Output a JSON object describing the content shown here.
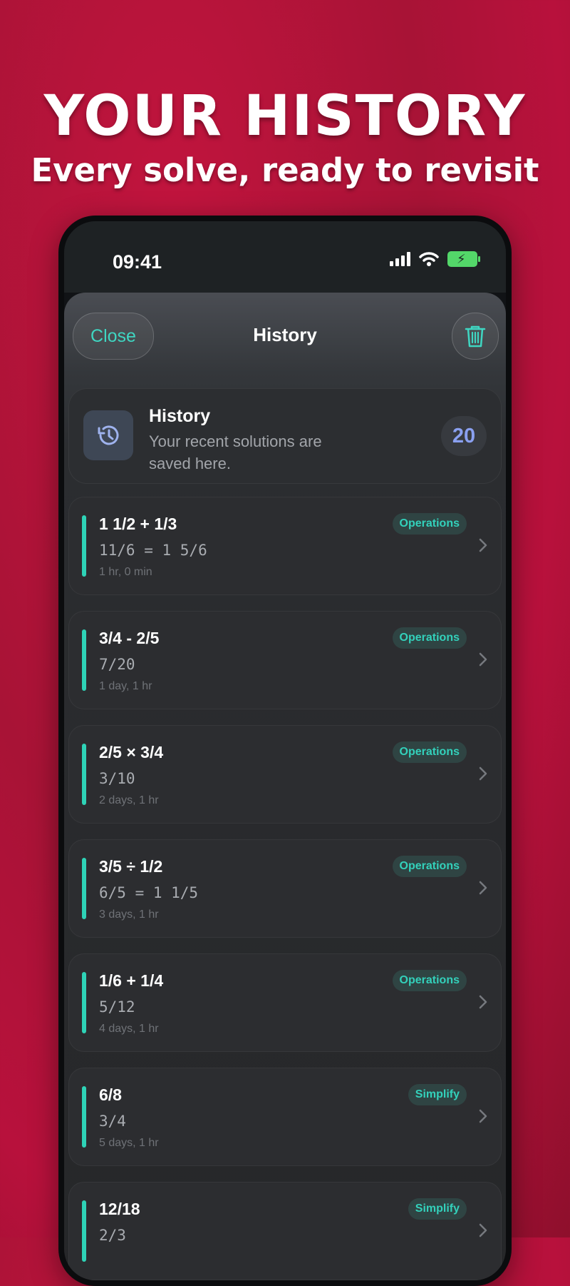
{
  "promo": {
    "title": "YOUR HISTORY",
    "subtitle": "Every solve, ready to revisit"
  },
  "status_bar": {
    "time": "09:41"
  },
  "header": {
    "close_label": "Close",
    "title": "History"
  },
  "summary": {
    "title": "History",
    "description": "Your recent solutions are saved here.",
    "count": "20"
  },
  "colors": {
    "accent": "#2ed3b7",
    "count_text": "#8aa0f0",
    "background": "#b8113c"
  },
  "items": [
    {
      "expression": "1 1/2 + 1/3",
      "result": "11/6 = 1 5/6",
      "time": "1 hr, 0 min",
      "tag": "Operations"
    },
    {
      "expression": "3/4 - 2/5",
      "result": "7/20",
      "time": "1 day, 1 hr",
      "tag": "Operations"
    },
    {
      "expression": "2/5 × 3/4",
      "result": "3/10",
      "time": "2 days, 1 hr",
      "tag": "Operations"
    },
    {
      "expression": "3/5 ÷ 1/2",
      "result": "6/5 = 1 1/5",
      "time": "3 days, 1 hr",
      "tag": "Operations"
    },
    {
      "expression": "1/6 + 1/4",
      "result": "5/12",
      "time": "4 days, 1 hr",
      "tag": "Operations"
    },
    {
      "expression": "6/8",
      "result": "3/4",
      "time": "5 days, 1 hr",
      "tag": "Simplify"
    },
    {
      "expression": "12/18",
      "result": "2/3",
      "time": "",
      "tag": "Simplify"
    }
  ]
}
